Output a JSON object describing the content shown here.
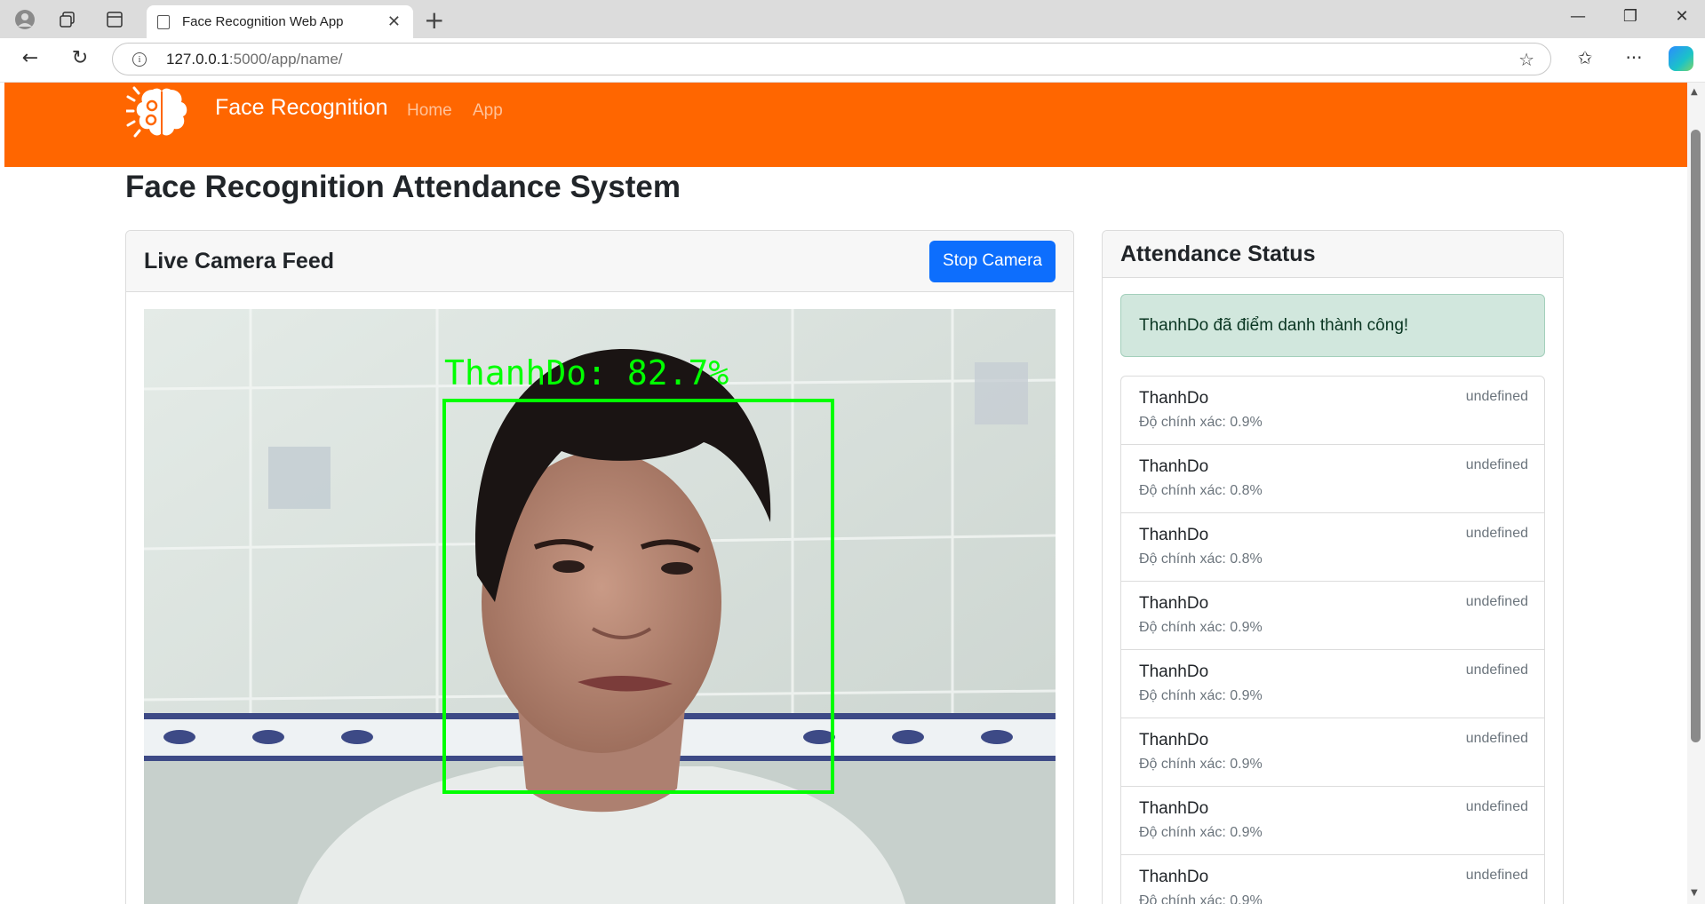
{
  "browser": {
    "tab_title": "Face Recognition Web App",
    "url_host": "127.0.0.1",
    "url_path": ":5000/app/name/"
  },
  "navbar": {
    "brand": "Face Recognition",
    "links": [
      "Home",
      "App"
    ],
    "bg_color": "#ff6600"
  },
  "page": {
    "title": "Face Recognition Attendance System"
  },
  "camera_card": {
    "title": "Live Camera Feed",
    "stop_button": "Stop Camera",
    "detection_label": "ThanhDo: 82.7%",
    "box_color": "#00ff00"
  },
  "attendance_card": {
    "title": "Attendance Status",
    "success_message": "ThanhDo đã điểm danh thành công!",
    "records": [
      {
        "name": "ThanhDo",
        "accuracy": "Độ chính xác: 0.9%",
        "time": "undefined"
      },
      {
        "name": "ThanhDo",
        "accuracy": "Độ chính xác: 0.8%",
        "time": "undefined"
      },
      {
        "name": "ThanhDo",
        "accuracy": "Độ chính xác: 0.8%",
        "time": "undefined"
      },
      {
        "name": "ThanhDo",
        "accuracy": "Độ chính xác: 0.9%",
        "time": "undefined"
      },
      {
        "name": "ThanhDo",
        "accuracy": "Độ chính xác: 0.9%",
        "time": "undefined"
      },
      {
        "name": "ThanhDo",
        "accuracy": "Độ chính xác: 0.9%",
        "time": "undefined"
      },
      {
        "name": "ThanhDo",
        "accuracy": "Độ chính xác: 0.9%",
        "time": "undefined"
      },
      {
        "name": "ThanhDo",
        "accuracy": "Độ chính xác: 0.9%",
        "time": "undefined"
      }
    ]
  }
}
